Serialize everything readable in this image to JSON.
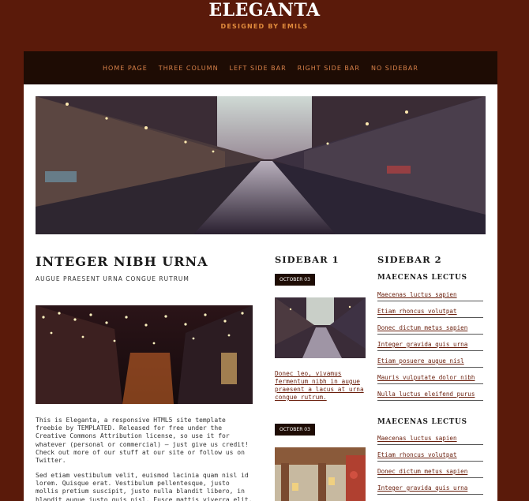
{
  "header": {
    "title": "ELEGANTA",
    "subtitle": "DESIGNED BY EMILS"
  },
  "nav": {
    "items": [
      "HOME PAGE",
      "THREE COLUMN",
      "LEFT SIDE BAR",
      "RIGHT SIDE BAR",
      "NO SIDEBAR"
    ]
  },
  "article": {
    "title": "INTEGER NIBH URNA",
    "subtitle": "AUGUE PRAESENT URNA CONGUE RUTRUM",
    "p1": "This is Eleganta, a responsive HTML5 site template freebie by TEMPLATED. Released for free under the Creative Commons Attribution license, so use it for whatever (personal or commercial) – just give us credit! Check out more of our stuff at our site or follow us on Twitter.",
    "p2": "Sed etiam vestibulum velit, euismod lacinia quam nisl id lorem. Quisque erat. Vestibulum pellentesque, justo mollis pretium suscipit, justo nulla blandit libero, in blandit augue justo quis nisl. Fusce mattis viverra elit."
  },
  "sidebar1": {
    "title": "SIDEBAR 1",
    "post1": {
      "date": "OCTOBER 03",
      "link": "Donec leo, vivamus fermentum nibh in augue praesent a lacus at urna congue rutrum."
    },
    "post2": {
      "date": "OCTOBER 03"
    }
  },
  "sidebar2": {
    "title": "SIDEBAR 2",
    "section1": {
      "heading": "MAECENAS LECTUS",
      "links": [
        "Maecenas luctus sapien",
        "Etiam rhoncus volutpat",
        "Donec dictum metus sapien",
        "Integer gravida quis urna",
        "Etiam posuere augue nisl",
        "Mauris vulputate dolor nibh",
        "Nulla luctus eleifend purus"
      ]
    },
    "section2": {
      "heading": "MAECENAS LECTUS",
      "links": [
        "Maecenas luctus sapien",
        "Etiam rhoncus volutpat",
        "Donec dictum metus sapien",
        "Integer gravida quis urna"
      ]
    }
  },
  "colors": {
    "background": "#5a1a0a",
    "nav_bg": "#1e0c04",
    "accent": "#d9824a",
    "link": "#6a1f0d"
  }
}
